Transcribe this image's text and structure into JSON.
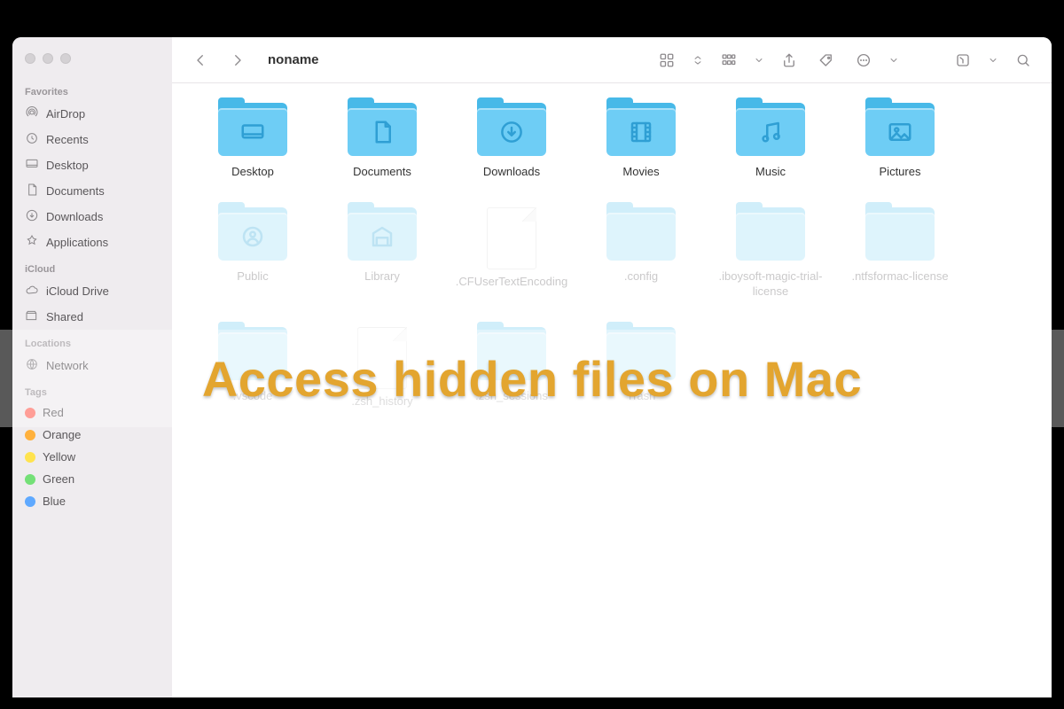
{
  "window_title": "noname",
  "headline": "Access hidden files on Mac",
  "sidebar": {
    "sections": [
      {
        "title": "Favorites",
        "items": [
          {
            "label": "AirDrop",
            "icon": "airdrop"
          },
          {
            "label": "Recents",
            "icon": "clock"
          },
          {
            "label": "Desktop",
            "icon": "desktop"
          },
          {
            "label": "Documents",
            "icon": "doc"
          },
          {
            "label": "Downloads",
            "icon": "download"
          },
          {
            "label": "Applications",
            "icon": "apps"
          }
        ]
      },
      {
        "title": "iCloud",
        "items": [
          {
            "label": "iCloud Drive",
            "icon": "cloud"
          },
          {
            "label": "Shared",
            "icon": "shared"
          }
        ]
      },
      {
        "title": "Locations",
        "items": [
          {
            "label": "Network",
            "icon": "globe"
          }
        ]
      },
      {
        "title": "Tags",
        "items": [
          {
            "label": "Red",
            "icon": "tag",
            "color": "#ff6b60"
          },
          {
            "label": "Orange",
            "icon": "tag",
            "color": "#ffb13d"
          },
          {
            "label": "Yellow",
            "icon": "tag",
            "color": "#ffe34e"
          },
          {
            "label": "Green",
            "icon": "tag",
            "color": "#74e077"
          },
          {
            "label": "Blue",
            "icon": "tag",
            "color": "#5fa9ff"
          }
        ]
      }
    ]
  },
  "items": [
    {
      "label": "Desktop",
      "kind": "folder",
      "glyph": "desktop",
      "hidden": false
    },
    {
      "label": "Documents",
      "kind": "folder",
      "glyph": "doc",
      "hidden": false
    },
    {
      "label": "Downloads",
      "kind": "folder",
      "glyph": "download",
      "hidden": false
    },
    {
      "label": "Movies",
      "kind": "folder",
      "glyph": "movie",
      "hidden": false
    },
    {
      "label": "Music",
      "kind": "folder",
      "glyph": "music",
      "hidden": false
    },
    {
      "label": "Pictures",
      "kind": "folder",
      "glyph": "picture",
      "hidden": false
    },
    {
      "label": "Public",
      "kind": "folder",
      "glyph": "public",
      "hidden": true
    },
    {
      "label": "Library",
      "kind": "folder",
      "glyph": "library",
      "hidden": true
    },
    {
      "label": ".CFUserTextEncoding",
      "kind": "file",
      "hidden": true
    },
    {
      "label": ".config",
      "kind": "folder",
      "glyph": "",
      "hidden": true
    },
    {
      "label": ".iboysoft-magic-trial-license",
      "kind": "folder",
      "glyph": "",
      "hidden": true
    },
    {
      "label": ".ntfsformac-license",
      "kind": "folder",
      "glyph": "",
      "hidden": true
    },
    {
      "label": ".vscode",
      "kind": "folder",
      "glyph": "",
      "hidden": true
    },
    {
      "label": ".zsh_history",
      "kind": "file",
      "hidden": true
    },
    {
      "label": ".zsh_sessions",
      "kind": "folder",
      "glyph": "",
      "hidden": true
    },
    {
      "label": "Trash",
      "kind": "folder",
      "glyph": "",
      "hidden": true
    }
  ]
}
